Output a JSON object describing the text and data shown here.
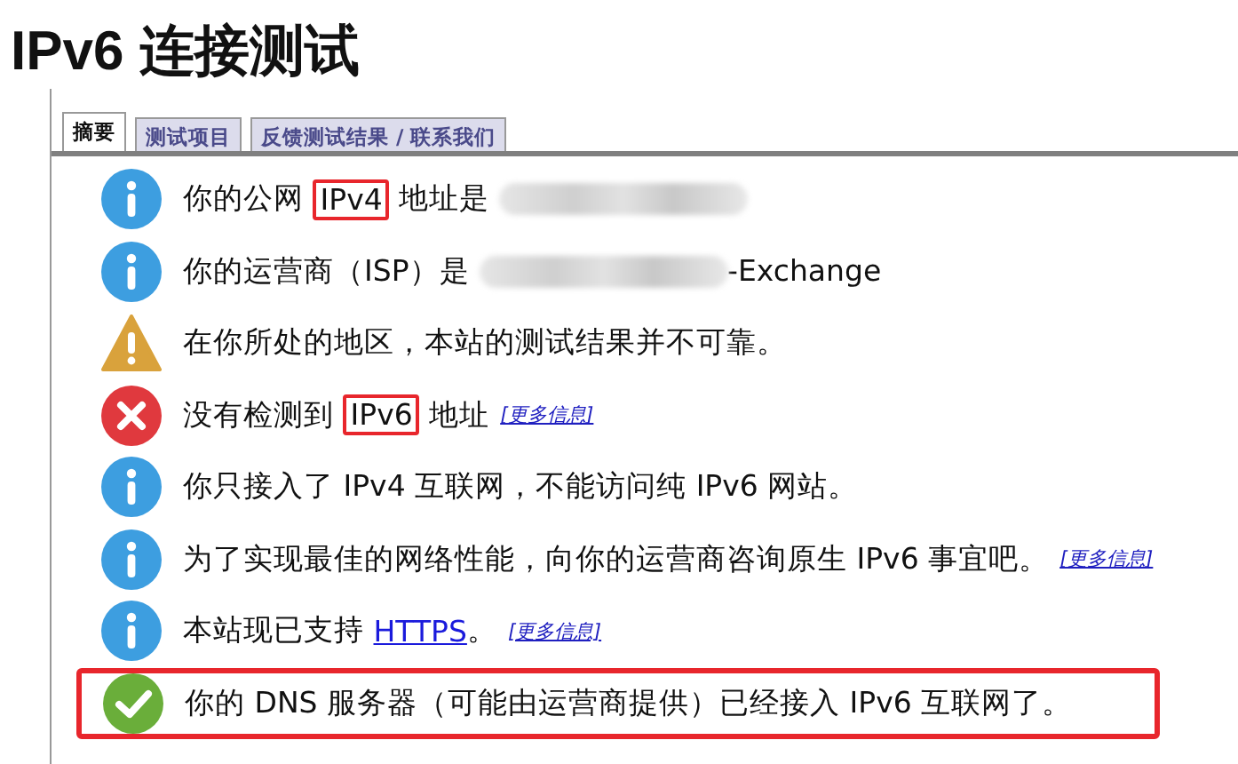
{
  "title": "IPv6 连接测试",
  "tabs": [
    {
      "label": "摘要",
      "selected": true
    },
    {
      "label": "测试项目",
      "selected": false
    },
    {
      "label": "反馈测试结果 / 联系我们",
      "selected": false
    }
  ],
  "rows": [
    {
      "kind": "info",
      "highlighted": false,
      "segments": [
        {
          "kind": "text",
          "text": "你的公网 "
        },
        {
          "kind": "highlight",
          "text": "IPv4"
        },
        {
          "kind": "text",
          "text": " 地址是 "
        },
        {
          "kind": "blur"
        }
      ]
    },
    {
      "kind": "info",
      "highlighted": false,
      "segments": [
        {
          "kind": "text",
          "text": "你的运营商（ISP）是 "
        },
        {
          "kind": "blur"
        },
        {
          "kind": "text",
          "text": "-Exchange"
        }
      ]
    },
    {
      "kind": "warning",
      "highlighted": false,
      "segments": [
        {
          "kind": "text",
          "text": "在你所处的地区，本站的测试结果并不可靠。"
        }
      ]
    },
    {
      "kind": "error",
      "highlighted": false,
      "segments": [
        {
          "kind": "text",
          "text": "没有检测到 "
        },
        {
          "kind": "highlight",
          "text": "IPv6"
        },
        {
          "kind": "text",
          "text": " 地址"
        },
        {
          "kind": "more",
          "text": "[更多信息]"
        }
      ]
    },
    {
      "kind": "info",
      "highlighted": false,
      "segments": [
        {
          "kind": "text",
          "text": "你只接入了 IPv4 互联网，不能访问纯 IPv6 网站。"
        }
      ]
    },
    {
      "kind": "info",
      "highlighted": false,
      "segments": [
        {
          "kind": "text",
          "text": "为了实现最佳的网络性能，向你的运营商咨询原生 IPv6 事宜吧。"
        },
        {
          "kind": "more",
          "text": "[更多信息]"
        }
      ]
    },
    {
      "kind": "info",
      "highlighted": false,
      "segments": [
        {
          "kind": "text",
          "text": "本站现已支持 "
        },
        {
          "kind": "link",
          "text": "HTTPS"
        },
        {
          "kind": "text",
          "text": "。"
        },
        {
          "kind": "more",
          "text": "[更多信息]"
        }
      ]
    },
    {
      "kind": "ok",
      "highlighted": true,
      "segments": [
        {
          "kind": "text",
          "text": "你的 DNS 服务器（可能由运营商提供）已经接入 IPv6 互联网了。"
        }
      ]
    }
  ]
}
